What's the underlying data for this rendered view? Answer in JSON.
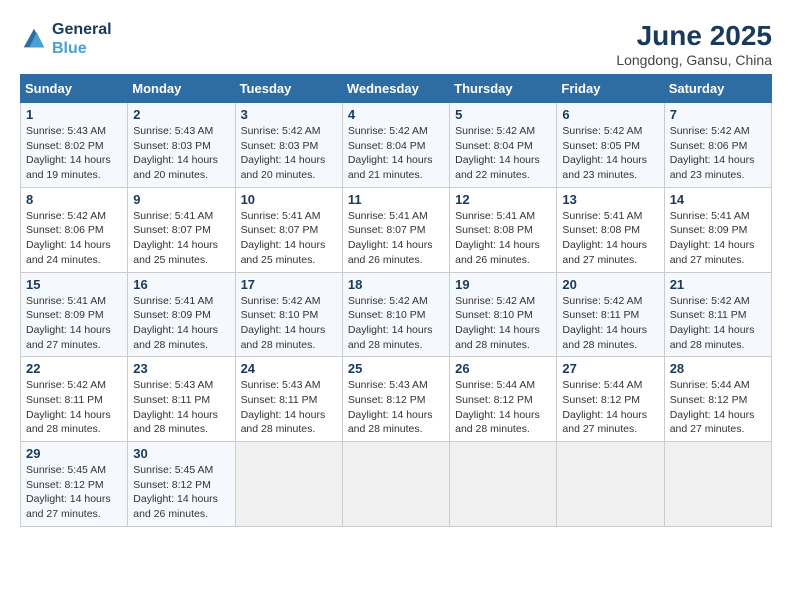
{
  "logo": {
    "line1": "General",
    "line2": "Blue"
  },
  "title": "June 2025",
  "subtitle": "Longdong, Gansu, China",
  "days_header": [
    "Sunday",
    "Monday",
    "Tuesday",
    "Wednesday",
    "Thursday",
    "Friday",
    "Saturday"
  ],
  "weeks": [
    [
      {
        "day": "1",
        "detail": "Sunrise: 5:43 AM\nSunset: 8:02 PM\nDaylight: 14 hours\nand 19 minutes."
      },
      {
        "day": "2",
        "detail": "Sunrise: 5:43 AM\nSunset: 8:03 PM\nDaylight: 14 hours\nand 20 minutes."
      },
      {
        "day": "3",
        "detail": "Sunrise: 5:42 AM\nSunset: 8:03 PM\nDaylight: 14 hours\nand 20 minutes."
      },
      {
        "day": "4",
        "detail": "Sunrise: 5:42 AM\nSunset: 8:04 PM\nDaylight: 14 hours\nand 21 minutes."
      },
      {
        "day": "5",
        "detail": "Sunrise: 5:42 AM\nSunset: 8:04 PM\nDaylight: 14 hours\nand 22 minutes."
      },
      {
        "day": "6",
        "detail": "Sunrise: 5:42 AM\nSunset: 8:05 PM\nDaylight: 14 hours\nand 23 minutes."
      },
      {
        "day": "7",
        "detail": "Sunrise: 5:42 AM\nSunset: 8:06 PM\nDaylight: 14 hours\nand 23 minutes."
      }
    ],
    [
      {
        "day": "8",
        "detail": "Sunrise: 5:42 AM\nSunset: 8:06 PM\nDaylight: 14 hours\nand 24 minutes."
      },
      {
        "day": "9",
        "detail": "Sunrise: 5:41 AM\nSunset: 8:07 PM\nDaylight: 14 hours\nand 25 minutes."
      },
      {
        "day": "10",
        "detail": "Sunrise: 5:41 AM\nSunset: 8:07 PM\nDaylight: 14 hours\nand 25 minutes."
      },
      {
        "day": "11",
        "detail": "Sunrise: 5:41 AM\nSunset: 8:07 PM\nDaylight: 14 hours\nand 26 minutes."
      },
      {
        "day": "12",
        "detail": "Sunrise: 5:41 AM\nSunset: 8:08 PM\nDaylight: 14 hours\nand 26 minutes."
      },
      {
        "day": "13",
        "detail": "Sunrise: 5:41 AM\nSunset: 8:08 PM\nDaylight: 14 hours\nand 27 minutes."
      },
      {
        "day": "14",
        "detail": "Sunrise: 5:41 AM\nSunset: 8:09 PM\nDaylight: 14 hours\nand 27 minutes."
      }
    ],
    [
      {
        "day": "15",
        "detail": "Sunrise: 5:41 AM\nSunset: 8:09 PM\nDaylight: 14 hours\nand 27 minutes."
      },
      {
        "day": "16",
        "detail": "Sunrise: 5:41 AM\nSunset: 8:09 PM\nDaylight: 14 hours\nand 28 minutes."
      },
      {
        "day": "17",
        "detail": "Sunrise: 5:42 AM\nSunset: 8:10 PM\nDaylight: 14 hours\nand 28 minutes."
      },
      {
        "day": "18",
        "detail": "Sunrise: 5:42 AM\nSunset: 8:10 PM\nDaylight: 14 hours\nand 28 minutes."
      },
      {
        "day": "19",
        "detail": "Sunrise: 5:42 AM\nSunset: 8:10 PM\nDaylight: 14 hours\nand 28 minutes."
      },
      {
        "day": "20",
        "detail": "Sunrise: 5:42 AM\nSunset: 8:11 PM\nDaylight: 14 hours\nand 28 minutes."
      },
      {
        "day": "21",
        "detail": "Sunrise: 5:42 AM\nSunset: 8:11 PM\nDaylight: 14 hours\nand 28 minutes."
      }
    ],
    [
      {
        "day": "22",
        "detail": "Sunrise: 5:42 AM\nSunset: 8:11 PM\nDaylight: 14 hours\nand 28 minutes."
      },
      {
        "day": "23",
        "detail": "Sunrise: 5:43 AM\nSunset: 8:11 PM\nDaylight: 14 hours\nand 28 minutes."
      },
      {
        "day": "24",
        "detail": "Sunrise: 5:43 AM\nSunset: 8:11 PM\nDaylight: 14 hours\nand 28 minutes."
      },
      {
        "day": "25",
        "detail": "Sunrise: 5:43 AM\nSunset: 8:12 PM\nDaylight: 14 hours\nand 28 minutes."
      },
      {
        "day": "26",
        "detail": "Sunrise: 5:44 AM\nSunset: 8:12 PM\nDaylight: 14 hours\nand 28 minutes."
      },
      {
        "day": "27",
        "detail": "Sunrise: 5:44 AM\nSunset: 8:12 PM\nDaylight: 14 hours\nand 27 minutes."
      },
      {
        "day": "28",
        "detail": "Sunrise: 5:44 AM\nSunset: 8:12 PM\nDaylight: 14 hours\nand 27 minutes."
      }
    ],
    [
      {
        "day": "29",
        "detail": "Sunrise: 5:45 AM\nSunset: 8:12 PM\nDaylight: 14 hours\nand 27 minutes."
      },
      {
        "day": "30",
        "detail": "Sunrise: 5:45 AM\nSunset: 8:12 PM\nDaylight: 14 hours\nand 26 minutes."
      },
      {
        "day": "",
        "detail": ""
      },
      {
        "day": "",
        "detail": ""
      },
      {
        "day": "",
        "detail": ""
      },
      {
        "day": "",
        "detail": ""
      },
      {
        "day": "",
        "detail": ""
      }
    ]
  ]
}
